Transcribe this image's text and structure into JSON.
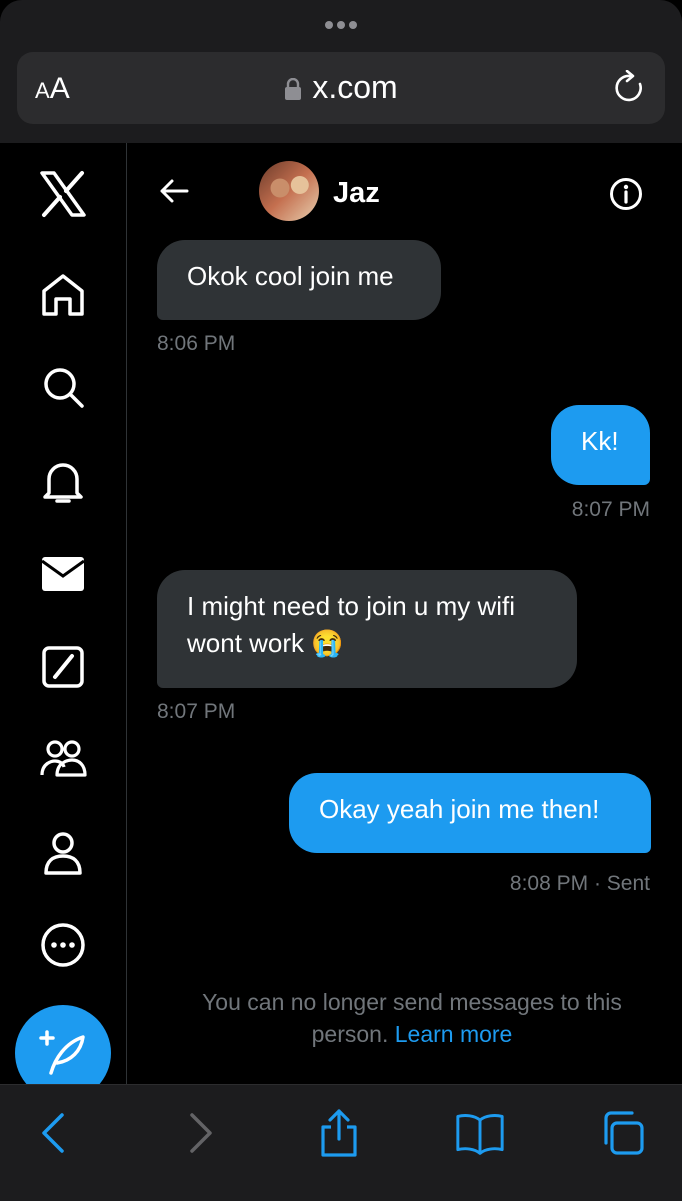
{
  "browser": {
    "text_size_label_small": "A",
    "text_size_label_large": "A",
    "url": "x.com"
  },
  "sidebar": {
    "items": [
      {
        "icon": "x-logo-icon"
      },
      {
        "icon": "home-icon"
      },
      {
        "icon": "search-icon"
      },
      {
        "icon": "bell-icon"
      },
      {
        "icon": "mail-icon"
      },
      {
        "icon": "grok-icon"
      },
      {
        "icon": "communities-icon"
      },
      {
        "icon": "profile-icon"
      },
      {
        "icon": "more-icon"
      }
    ],
    "compose_icon": "compose-post-icon"
  },
  "chat": {
    "contact_name": "Jaz",
    "messages": [
      {
        "from": "them",
        "text": "Okok cool join me",
        "time": "8:06 PM"
      },
      {
        "from": "me",
        "text": "Kk!",
        "time": "8:07 PM"
      },
      {
        "from": "them",
        "text_line1": "I might need to join u my wifi",
        "text_line2": "wont work 😭",
        "time": "8:07 PM"
      },
      {
        "from": "me",
        "text": "Okay yeah join me then!",
        "time": "8:08 PM · Sent"
      }
    ],
    "notice_line1": "You can no longer send messages to this",
    "notice_line2": "person.",
    "notice_link": "Learn more"
  },
  "colors": {
    "accent": "#1d9bf0",
    "incoming_bubble": "#2f3336",
    "muted_text": "#71767b"
  }
}
